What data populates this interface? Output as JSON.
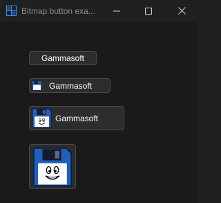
{
  "window": {
    "title": "Bitmap button exa...",
    "icons": {
      "app": "app-grid-icon",
      "minimize": "minimize-icon",
      "maximize": "maximize-icon",
      "close": "close-icon"
    }
  },
  "buttons": [
    {
      "label": "Gammasoft",
      "icon": "none"
    },
    {
      "label": "Gammasoft",
      "icon": "floppy-disk-small-icon"
    },
    {
      "label": "Gammasoft",
      "icon": "floppy-disk-medium-icon"
    },
    {
      "label": "",
      "icon": "floppy-disk-large-icon"
    }
  ],
  "colors": {
    "background": "#1a1a1a",
    "button_face": "#2d2d2d",
    "button_border": "#4a4a4a",
    "floppy_blue": "#1f5fbf",
    "app_icon_blue": "#3a8ee6"
  }
}
